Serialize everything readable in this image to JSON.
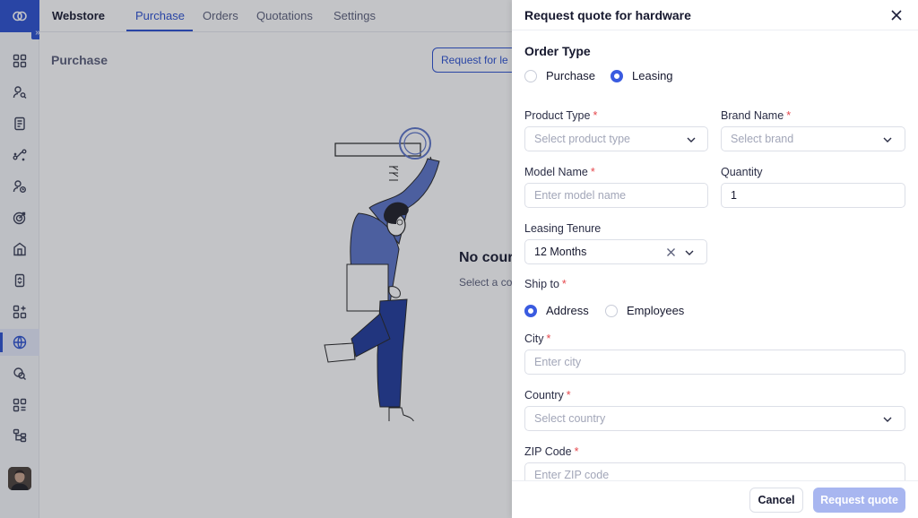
{
  "topnav": {
    "brand": "Webstore",
    "tabs": [
      {
        "label": "Purchase",
        "active": true
      },
      {
        "label": "Orders",
        "active": false
      },
      {
        "label": "Quotations",
        "active": false
      },
      {
        "label": "Settings",
        "active": false
      }
    ]
  },
  "rail": {
    "icons": [
      "dashboard-icon",
      "user-search-icon",
      "document-icon",
      "route-icon",
      "user-clock-icon",
      "target-icon",
      "building-icon",
      "device-sync-icon",
      "apps-add-icon",
      "webstore-icon",
      "search-chat-icon",
      "modules-icon",
      "hierarchy-icon"
    ],
    "active_index": 9
  },
  "main": {
    "page_title": "Purchase",
    "request_button": "Request for le",
    "empty_title": "No cour",
    "empty_subtitle": "Select a co"
  },
  "drawer": {
    "title": "Request quote for hardware",
    "order_type": {
      "title": "Order Type",
      "options": [
        {
          "label": "Purchase",
          "selected": false
        },
        {
          "label": "Leasing",
          "selected": true
        }
      ]
    },
    "product_type": {
      "label": "Product Type",
      "placeholder": "Select product type"
    },
    "brand_name": {
      "label": "Brand Name",
      "placeholder": "Select brand"
    },
    "model_name": {
      "label": "Model Name",
      "placeholder": "Enter model name"
    },
    "quantity": {
      "label": "Quantity",
      "value": "1"
    },
    "leasing_tenure": {
      "label": "Leasing Tenure",
      "value": "12 Months"
    },
    "ship_to": {
      "label": "Ship to",
      "options": [
        {
          "label": "Address",
          "selected": true
        },
        {
          "label": "Employees",
          "selected": false
        }
      ]
    },
    "city": {
      "label": "City",
      "placeholder": "Enter city"
    },
    "country": {
      "label": "Country",
      "placeholder": "Select country"
    },
    "zip": {
      "label": "ZIP Code",
      "placeholder": "Enter ZIP code"
    },
    "required_mark": "*",
    "cancel": "Cancel",
    "submit": "Request quote"
  },
  "colors": {
    "accent": "#2a4fd0",
    "radio_on": "#3a5be0",
    "required": "#e5484d",
    "submit_disabled": "#a8b6f0",
    "illustration_sweater": "#5b73c8",
    "illustration_pants": "#1f3a9a"
  }
}
